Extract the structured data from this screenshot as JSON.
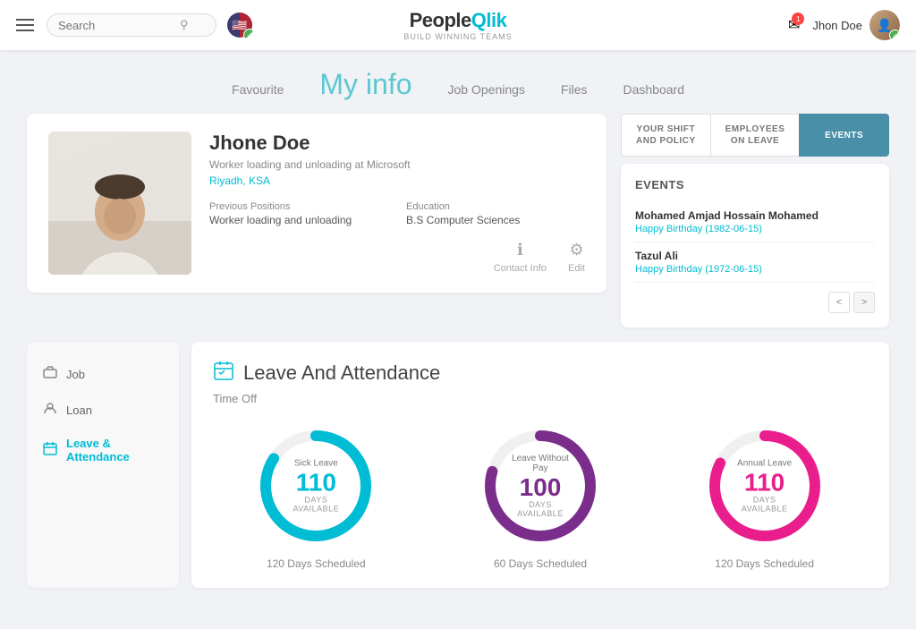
{
  "header": {
    "search_placeholder": "Search",
    "logo_brand": "PeopleQlik",
    "logo_sub": "Build Winning Teams",
    "notif_count": "1",
    "user_name": "Jhon Doe"
  },
  "nav": {
    "tabs": [
      {
        "label": "Favourite",
        "active": false
      },
      {
        "label": "My info",
        "active": true
      },
      {
        "label": "Job Openings",
        "active": false
      },
      {
        "label": "Files",
        "active": false
      },
      {
        "label": "Dashboard",
        "active": false
      }
    ]
  },
  "profile": {
    "name": "Jhone Doe",
    "title": "Worker loading and unloading at Microsoft",
    "location": "Riyadh, KSA",
    "previous_positions_label": "Previous Positions",
    "previous_positions_value": "Worker loading and unloading",
    "education_label": "Education",
    "education_value": "B.S Computer Sciences",
    "contact_info_label": "Contact Info",
    "edit_label": "Edit"
  },
  "shift_buttons": {
    "btn1": "YOUR SHIFT\nAND POLICY",
    "btn2": "EMPLOYEES\nON LEAVE",
    "btn3": "EVENTS"
  },
  "events": {
    "title": "EVENTS",
    "items": [
      {
        "name": "Mohamed Amjad Hossain Mohamed",
        "sub": "Happy Birthday (1982-06-15)"
      },
      {
        "name": "Tazul Ali",
        "sub": "Happy Birthday (1972-06-15)"
      }
    ],
    "prev": "<",
    "next": ">"
  },
  "sidebar": {
    "items": [
      {
        "label": "Job",
        "icon": "briefcase",
        "active": false
      },
      {
        "label": "Loan",
        "icon": "user-circle",
        "active": false
      },
      {
        "label": "Leave & Attendance",
        "icon": "calendar",
        "active": true
      }
    ]
  },
  "leave_section": {
    "title": "Leave And Attendance",
    "time_off_label": "Time Off",
    "charts": [
      {
        "label": "Sick Leave",
        "number": "110",
        "sub": "DAYS AVAILABLE",
        "bottom": "120 Days Scheduled",
        "color": "#00bcd4",
        "percent": 0.85,
        "circumference": 376.99
      },
      {
        "label": "Leave Without Pay",
        "number": "100",
        "sub": "DAYS AVAILABLE",
        "bottom": "60 Days Scheduled",
        "color": "#7b2d8b",
        "percent": 0.78,
        "circumference": 376.99
      },
      {
        "label": "Annual Leave",
        "number": "110",
        "sub": "DAYS AVAILABLE",
        "bottom": "120 Days Scheduled",
        "color": "#e91e8c",
        "percent": 0.82,
        "circumference": 376.99
      }
    ]
  }
}
